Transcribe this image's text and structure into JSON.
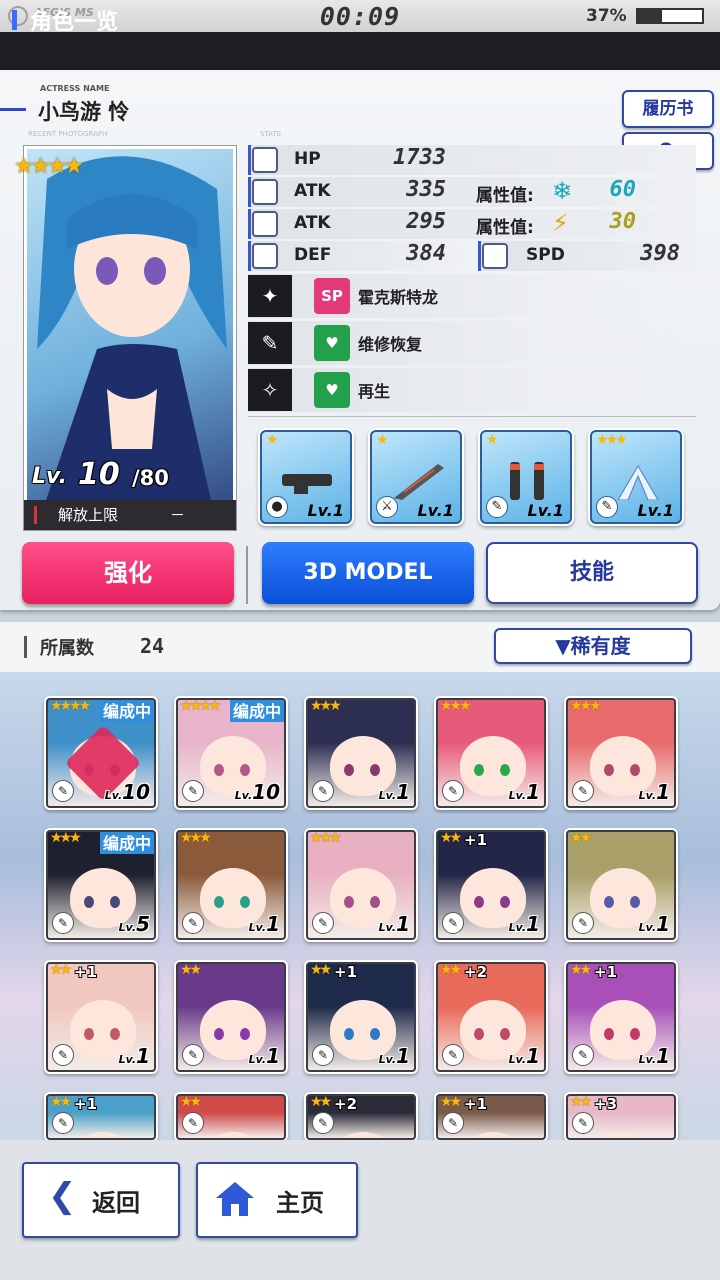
{
  "status_bar": {
    "logo": "AEGIS MS",
    "timer": "00:09",
    "battery_text": "37%",
    "battery_level": 0.37
  },
  "header": {
    "title": "角色一览"
  },
  "actress": {
    "label": "ACTRESS NAME",
    "name": "小鸟游 怜",
    "recent_label": "RECENT PHOTOGRAPH",
    "state_label": "STATE"
  },
  "buttons": {
    "resume": "履历书",
    "upgrade": "强化",
    "model": "3D MODEL",
    "skill": "技能",
    "sort": "▼稀有度",
    "back": "返回",
    "home": "主页"
  },
  "portrait": {
    "stars": "★★★★",
    "lv_prefix": "Lv.",
    "level": "10",
    "max_level": "/80",
    "limit_label": "解放上限",
    "limit_value": "－"
  },
  "stats": {
    "hp_label": "HP",
    "hp": "1733",
    "atk1_label": "ATK",
    "atk1": "335",
    "atk2_label": "ATK",
    "atk2": "295",
    "def_label": "DEF",
    "def": "384",
    "spd_label": "SPD",
    "spd": "398",
    "attr1_label": "属性值:",
    "attr1": "60",
    "attr1_color": "#1aa9b8",
    "attr2_label": "属性值:",
    "attr2": "30",
    "attr2_color": "#a8a020"
  },
  "skills": [
    {
      "badge": "SP",
      "name": "霍克斯特龙",
      "badge_color": "#e43a7c"
    },
    {
      "badge": "♥",
      "name": "维修恢复",
      "badge_color": "#22a04a"
    },
    {
      "badge": "♥",
      "name": "再生",
      "badge_color": "#22a04a"
    }
  ],
  "weapons": [
    {
      "stars": "★",
      "lv": "Lv.1",
      "icon": "cannon"
    },
    {
      "stars": "★",
      "lv": "Lv.1",
      "icon": "sword"
    },
    {
      "stars": "★",
      "lv": "Lv.1",
      "icon": "legs"
    },
    {
      "stars": "★★★",
      "lv": "Lv.1",
      "icon": "wings"
    }
  ],
  "list": {
    "count_label": "所属数",
    "count": "24"
  },
  "characters": [
    {
      "stars": "★★★★",
      "plus": "",
      "team": "编成中",
      "level": "10",
      "hair": "#3f8fc8",
      "eye": "#7a5ab8",
      "checked": true
    },
    {
      "stars": "★★★★",
      "plus": "",
      "team": "编成中",
      "level": "10",
      "hair": "#e7b4c9",
      "eye": "#b05a8a",
      "checked": false
    },
    {
      "stars": "★★★",
      "plus": "",
      "team": "",
      "level": "1",
      "hair": "#2c2e52",
      "eye": "#8a3a6a",
      "checked": false
    },
    {
      "stars": "★★★",
      "plus": "",
      "team": "",
      "level": "1",
      "hair": "#e85a7a",
      "eye": "#2aa84a",
      "checked": false
    },
    {
      "stars": "★★★",
      "plus": "",
      "team": "",
      "level": "1",
      "hair": "#e86a6a",
      "eye": "#b04a6a",
      "checked": false
    },
    {
      "stars": "★★★",
      "plus": "",
      "team": "编成中",
      "level": "5",
      "hair": "#1e2030",
      "eye": "#4a4a7a",
      "checked": false
    },
    {
      "stars": "★★★",
      "plus": "",
      "team": "",
      "level": "1",
      "hair": "#8a5a3a",
      "eye": "#2aa088",
      "checked": false
    },
    {
      "stars": "★★★",
      "plus": "",
      "team": "",
      "level": "1",
      "hair": "#e8b0c0",
      "eye": "#a0508a",
      "checked": false
    },
    {
      "stars": "★★",
      "plus": "+1",
      "team": "",
      "level": "1",
      "hair": "#232648",
      "eye": "#8a3a8a",
      "checked": false
    },
    {
      "stars": "★★",
      "plus": "",
      "team": "",
      "level": "1",
      "hair": "#a8a068",
      "eye": "#5a5aa8",
      "checked": false
    },
    {
      "stars": "★★",
      "plus": "+1",
      "team": "",
      "level": "1",
      "hair": "#f0c8c0",
      "eye": "#c05a6a",
      "checked": false
    },
    {
      "stars": "★★",
      "plus": "",
      "team": "",
      "level": "1",
      "hair": "#6a3a8a",
      "eye": "#8a3aa8",
      "checked": false
    },
    {
      "stars": "★★",
      "plus": "+1",
      "team": "",
      "level": "1",
      "hair": "#1e2a4a",
      "eye": "#2a7ac8",
      "checked": false
    },
    {
      "stars": "★★",
      "plus": "+2",
      "team": "",
      "level": "1",
      "hair": "#e86a5a",
      "eye": "#c04a6a",
      "checked": false
    },
    {
      "stars": "★★",
      "plus": "+1",
      "team": "",
      "level": "1",
      "hair": "#a850b8",
      "eye": "#c03a6a",
      "checked": false
    },
    {
      "stars": "★★",
      "plus": "+1",
      "team": "",
      "level": "",
      "hair": "#4aa0c8",
      "eye": "#5a5aa8",
      "checked": false
    },
    {
      "stars": "★★",
      "plus": "",
      "team": "",
      "level": "",
      "hair": "#d04a4a",
      "eye": "#8a3a3a",
      "checked": false
    },
    {
      "stars": "★★",
      "plus": "+2",
      "team": "",
      "level": "",
      "hair": "#2a2a38",
      "eye": "#4a4a7a",
      "checked": false
    },
    {
      "stars": "★★",
      "plus": "+1",
      "team": "",
      "level": "",
      "hair": "#7a5a4a",
      "eye": "#5a3a3a",
      "checked": false
    },
    {
      "stars": "★★",
      "plus": "+3",
      "team": "",
      "level": "",
      "hair": "#e8b8c8",
      "eye": "#a05a8a",
      "checked": false
    }
  ]
}
